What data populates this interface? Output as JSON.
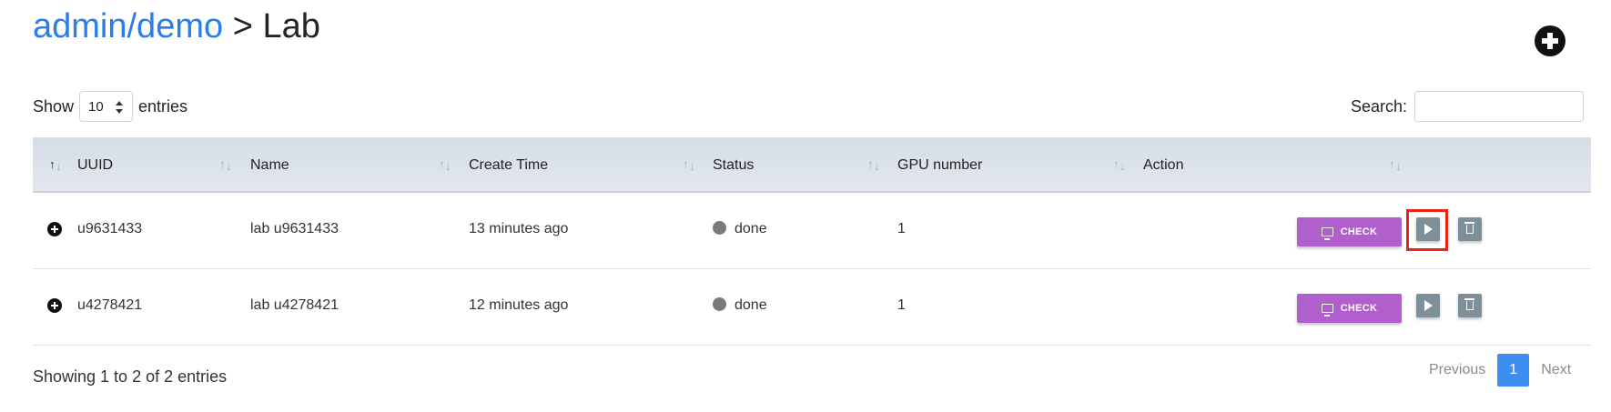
{
  "breadcrumb": {
    "link": "admin/demo",
    "separator": ">",
    "current": "Lab"
  },
  "length_menu": {
    "show_label": "Show",
    "value": "10",
    "entries_label": "entries"
  },
  "search": {
    "label": "Search:",
    "value": "",
    "placeholder": ""
  },
  "table": {
    "columns": [
      "UUID",
      "Name",
      "Create Time",
      "Status",
      "GPU number",
      "Action"
    ],
    "rows": [
      {
        "uuid": "u9631433",
        "name": "lab u9631433",
        "create_time": "13 minutes ago",
        "status": "done",
        "gpu_number": "1",
        "check_label": "CHECK"
      },
      {
        "uuid": "u4278421",
        "name": "lab u4278421",
        "create_time": "12 minutes ago",
        "status": "done",
        "gpu_number": "1",
        "check_label": "CHECK"
      }
    ]
  },
  "footer": {
    "info": "Showing 1 to 2 of 2 entries"
  },
  "pagination": {
    "previous": "Previous",
    "current_page": "1",
    "next": "Next"
  },
  "icons": {
    "add": "plus-circle-icon",
    "expand": "plus-circle-icon",
    "check": "monitor-icon",
    "start": "play-icon",
    "delete": "trash-icon"
  },
  "colors": {
    "link": "#2b7de9",
    "check_button": "#b05fcc",
    "action_button": "#7d9099",
    "status_done": "#7a7a7a",
    "highlight": "#ee2211",
    "page_active": "#3d8ef2"
  }
}
